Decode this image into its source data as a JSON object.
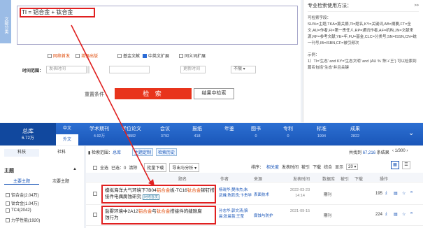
{
  "search": {
    "side_tab": "文献分类",
    "query": "TI = 铝合金 + 钛合金",
    "options": [
      {
        "label": "网络首发",
        "checked": false,
        "orange": true
      },
      {
        "label": "增强出版",
        "checked": false,
        "orange": true
      },
      {
        "label": "基金文献",
        "checked": false,
        "orange": false
      },
      {
        "label": "中英文扩展",
        "checked": true,
        "orange": false
      },
      {
        "label": "同义词扩展",
        "checked": false,
        "orange": false
      }
    ],
    "time_label": "时间范围：",
    "start_placeholder": "发表时间",
    "update_label": "更新时间",
    "update_value": "不限",
    "reset": "重置条件",
    "search_btn": "检 索",
    "result_btn": "结果中检索"
  },
  "help": {
    "title": "专业检索使用方法：",
    "more": ">>",
    "fields_title": "可检索字段：",
    "fields": "SU%=主题,TKA=篇关摘,TI=题名,KY=关键词,AB=摘要,FT=全文,AU=作者,FI=第一责任人,RP=通讯作者,AF=机构,JN=文献来源,RF=参考文献,YE=年,FU=基金,CLC=分类号,SN=ISSN,CN=统一刊号,IB=ISBN,CF=被引频次",
    "example_title": "示例：",
    "example1": "1）TI='生态' and KY='生态文明' and (AU % '陈'+'王') 可以检索到篇名包括\"生态\"并且关键"
  },
  "nav": {
    "total_label": "总库",
    "total_count": "6.72万",
    "tab_cn": "中文",
    "tab_en": "外文",
    "items": [
      {
        "label": "学术期刊",
        "count": "4.92万"
      },
      {
        "label": "学位论文",
        "count": "8882"
      },
      {
        "label": "会议",
        "count": "3792"
      },
      {
        "label": "报纸",
        "count": "418"
      },
      {
        "label": "年鉴",
        "count": ""
      },
      {
        "label": "图书",
        "count": "0"
      },
      {
        "label": "专利",
        "count": "0"
      },
      {
        "label": "标准",
        "count": "1994"
      },
      {
        "label": "成果",
        "count": "2822"
      }
    ]
  },
  "left": {
    "tab1": "科技",
    "tab2": "社科",
    "group": "主题",
    "sub1": "主要主题",
    "sub2": "次要主题",
    "items": [
      "铝合金(2.04万)",
      "钛合金(1.04万)",
      "TC4(2042)",
      "力学性能(1920)"
    ]
  },
  "main": {
    "scope_prefix": "检索范围：",
    "scope": "总库",
    "topic_tag": "主题定制",
    "history_tag": "检索历史",
    "found_prefix": "共找到",
    "found": "67,216",
    "found_suffix": "条结果",
    "page": "1/300",
    "toolbar": {
      "all": "全选",
      "selected": "已选：0",
      "clear": "清除",
      "batch": "批量下载",
      "export": "导出与分析",
      "sort": "排序：",
      "sort_rel": "相关度",
      "sort_date": "发表时间",
      "sort_cite": "被引",
      "sort_dl": "下载",
      "sort_all": "综合",
      "show": "显示",
      "show_n": "20"
    },
    "headers": [
      "题名",
      "作者",
      "来源",
      "发表时间",
      "数据库",
      "被引",
      "下载",
      "操作"
    ],
    "rows": [
      {
        "title_parts": [
          "模拟海洋大气环境下7B04",
          "铝合金",
          "板-TC16",
          "钛合金",
          "铆钉搭接件电偶腐蚀研究"
        ],
        "badge": "网络首发",
        "authors": "杨晓华;樊伟杰;朱\n武峰;陈跃良;卞贵学",
        "source": "表面技术",
        "date": "2022-03-23\n14:14",
        "db": "期刊",
        "cite": "",
        "download": "195"
      },
      {
        "title_parts": [
          "盐雾环境中2A12",
          "铝合金",
          "与",
          "钛合金",
          "搭接件的缝隙腐\n蚀行为"
        ],
        "badge": "",
        "authors": "孙志华;郭文清;骆\n晨;张晨苗;王莹",
        "source": "腐蚀与防护",
        "date": "2021-09-15",
        "db": "期刊",
        "cite": "",
        "download": "224"
      }
    ]
  }
}
